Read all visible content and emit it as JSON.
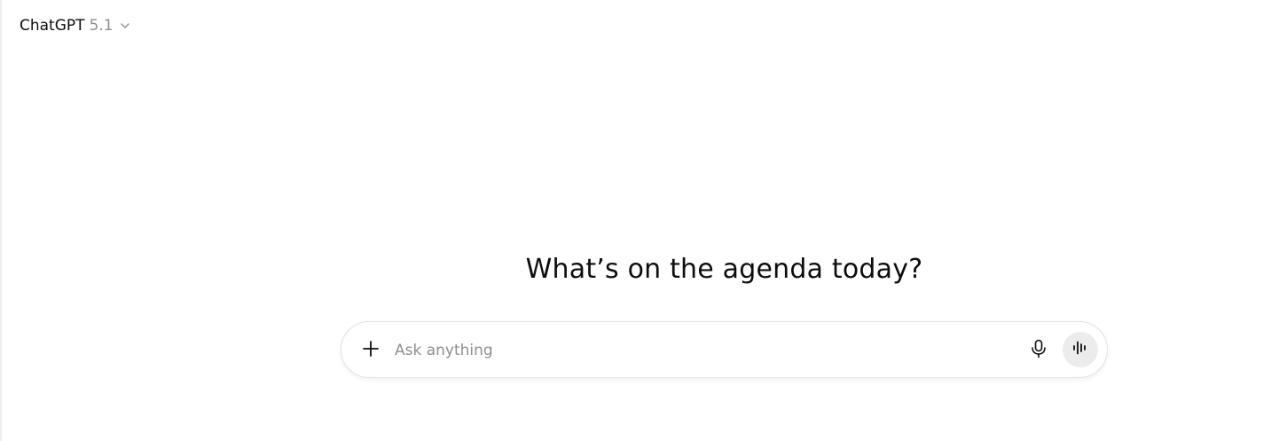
{
  "header": {
    "model_name": "ChatGPT",
    "model_version": "5.1",
    "chevron_icon": "chevron-down-icon"
  },
  "main": {
    "heading": "What’s on the agenda today?"
  },
  "composer": {
    "placeholder": "Ask anything",
    "value": "",
    "plus_icon": "plus-icon",
    "mic_icon": "microphone-icon",
    "voice_icon": "voice-waveform-icon",
    "voice_button_bg": "#ececec"
  }
}
